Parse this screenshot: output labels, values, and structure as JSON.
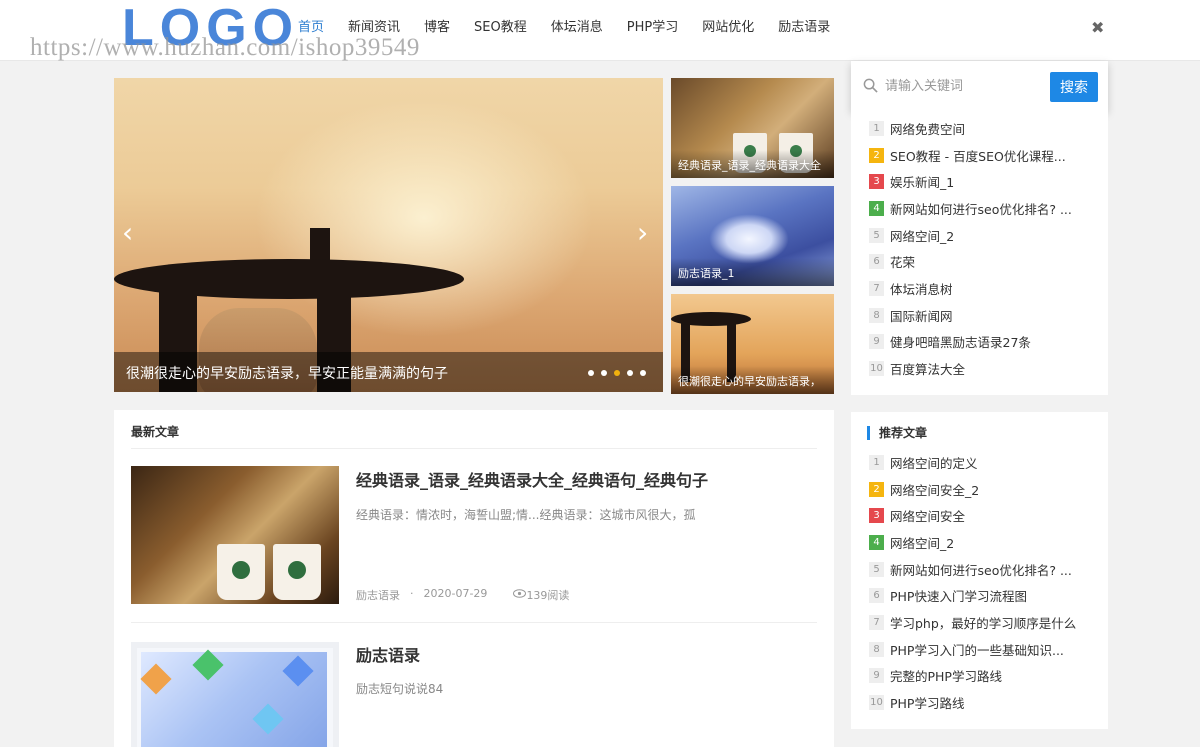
{
  "header": {
    "logo": "LOGO",
    "watermark": "https://www.huzhan.com/ishop39549",
    "nav": [
      "首页",
      "新闻资讯",
      "博客",
      "SEO教程",
      "体坛消息",
      "PHP学习",
      "网站优化",
      "励志语录"
    ],
    "close_icon": "✖"
  },
  "search": {
    "placeholder": "请输入关键词",
    "button_label": "搜索"
  },
  "slider": {
    "caption": "很潮很走心的早安励志语录，早安正能量满满的句子",
    "prev": "‹",
    "next": "›",
    "dots": 5,
    "active_dot": 2
  },
  "thumbs": [
    {
      "caption": "经典语录_语录_经典语录大全"
    },
    {
      "caption": "励志语录_1"
    },
    {
      "caption": "很潮很走心的早安励志语录，"
    }
  ],
  "hot_list": {
    "items": [
      {
        "num": "1",
        "text": "网络免费空间"
      },
      {
        "num": "2",
        "text": "SEO教程 - 百度SEO优化课程..."
      },
      {
        "num": "3",
        "text": "娱乐新闻_1"
      },
      {
        "num": "4",
        "text": "新网站如何进行seo优化排名? ..."
      },
      {
        "num": "5",
        "text": "网络空间_2"
      },
      {
        "num": "6",
        "text": "花荣"
      },
      {
        "num": "7",
        "text": "体坛消息树"
      },
      {
        "num": "8",
        "text": "国际新闻网"
      },
      {
        "num": "9",
        "text": "健身吧暗黑励志语录27条"
      },
      {
        "num": "10",
        "text": "百度算法大全"
      }
    ]
  },
  "recommend": {
    "title": "推荐文章",
    "items": [
      {
        "num": "1",
        "text": "网络空间的定义"
      },
      {
        "num": "2",
        "text": "网络空间安全_2"
      },
      {
        "num": "3",
        "text": "网络空间安全"
      },
      {
        "num": "4",
        "text": "网络空间_2"
      },
      {
        "num": "5",
        "text": "新网站如何进行seo优化排名? ..."
      },
      {
        "num": "6",
        "text": "PHP快速入门学习流程图"
      },
      {
        "num": "7",
        "text": "学习php，最好的学习顺序是什么"
      },
      {
        "num": "8",
        "text": "PHP学习入门的一些基础知识..."
      },
      {
        "num": "9",
        "text": "完整的PHP学习路线"
      },
      {
        "num": "10",
        "text": "PHP学习路线"
      }
    ]
  },
  "latest": {
    "title": "最新文章",
    "articles": [
      {
        "title": "经典语录_语录_经典语录大全_经典语句_经典句子",
        "summary": "经典语录：情浓时，海誓山盟;情...经典语录：这城市风很大，孤",
        "category": "励志语录",
        "date": "2020-07-29",
        "views": "139阅读"
      },
      {
        "title": "励志语录",
        "summary": "励志短句说说84"
      }
    ]
  },
  "colors": {
    "accent": "#1e88e5",
    "nav_active": "#2f7fd1",
    "rank_1": "#f5b50f",
    "rank_2": "#e5484d",
    "rank_3": "#4cae4c"
  }
}
